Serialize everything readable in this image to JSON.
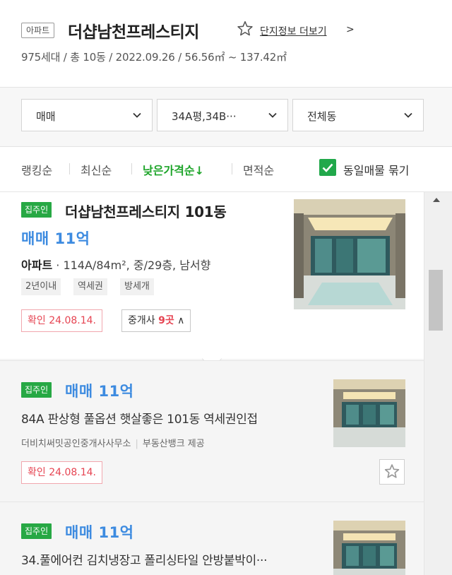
{
  "header": {
    "type_tag": "아파트",
    "title": "더샵남천프레스티지",
    "more_link": "단지정보 더보기",
    "more_chevron": ">",
    "subtitle": "975세대 / 총 10동 / 2022.09.26 / 56.56㎡ ~ 137.42㎡"
  },
  "filters": {
    "trade_type": "매매",
    "area": "34A평,34B···",
    "building": "전체동"
  },
  "sort": {
    "items": [
      "랭킹순",
      "최신순",
      "낮은가격순↓",
      "면적순"
    ],
    "active_index": 2,
    "group_label": "동일매물 묶기",
    "group_checked": true
  },
  "listings": [
    {
      "badge": "집주인",
      "title": "더샵남천프레스티지 101동",
      "price": "매매 11억",
      "spec_type": "아파트",
      "spec_detail": "· 114A/84m², 중/29층, 남서향",
      "tags": [
        "2년이내",
        "역세권",
        "방세개"
      ],
      "confirmed": "확인 24.08.14.",
      "agent_label": "중개사",
      "agent_count": "9곳",
      "agent_chevron": "∧"
    },
    {
      "badge": "집주인",
      "price": "매매 11억",
      "desc": "84A 판상형 풀옵션 햇살좋은 101동 역세권인접",
      "agency": "더비치써밋공인중개사사무소",
      "provider": "부동산뱅크 제공",
      "confirmed": "확인 24.08.14."
    },
    {
      "badge": "집주인",
      "price": "매매 11억",
      "desc": "34.풀에어컨 김치냉장고 폴리싱타일 안방붙박이···"
    }
  ],
  "colors": {
    "green": "#1fa52b",
    "price_blue": "#3d8be0",
    "confirm_red": "#e64452"
  }
}
